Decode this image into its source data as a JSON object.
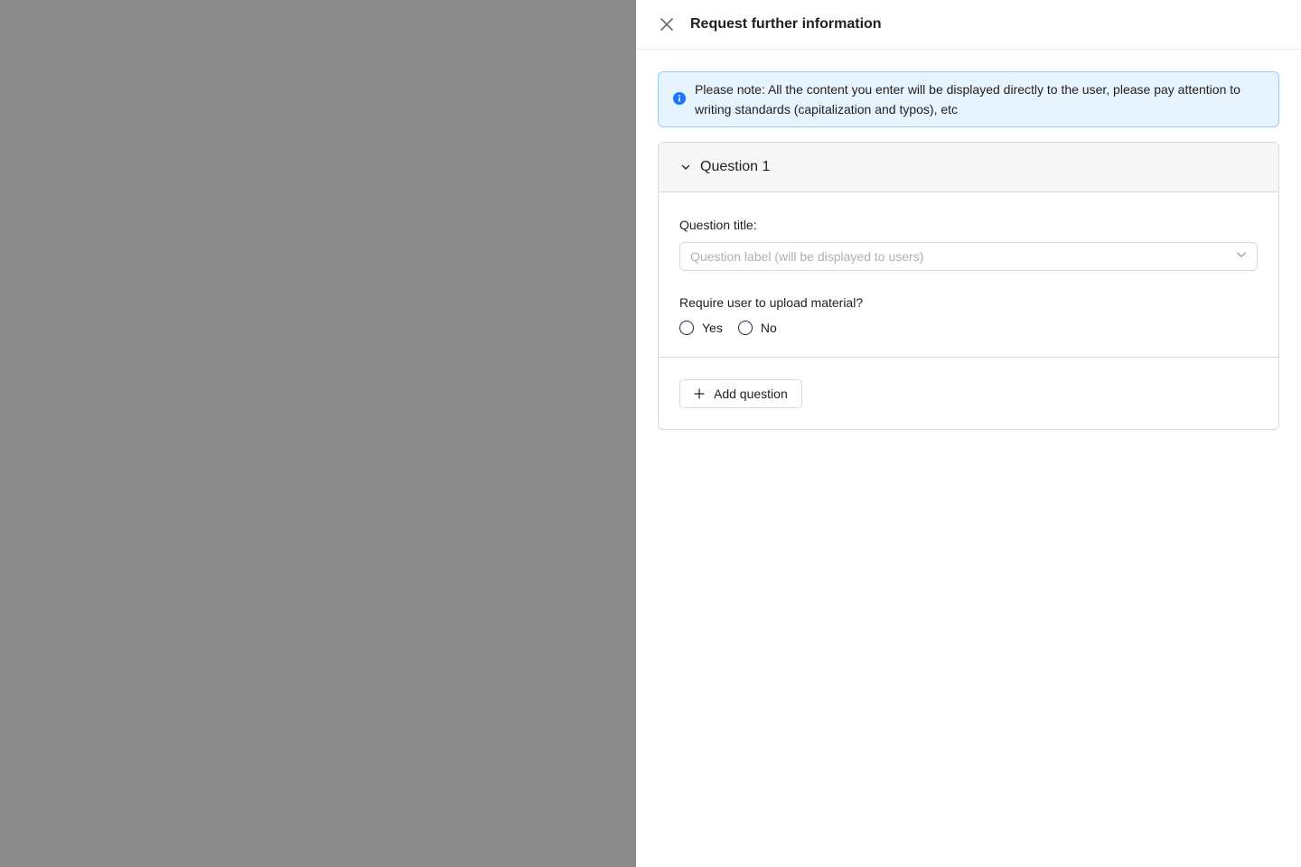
{
  "drawer": {
    "title": "Request further information",
    "close_icon": "close-icon"
  },
  "alert": {
    "icon": "info-icon",
    "color": "#1677ff",
    "text": "Please note: All the content you enter will be displayed directly to the user, please pay attention to writing standards (capitalization and typos), etc"
  },
  "questions": [
    {
      "header": "Question 1",
      "expanded": true,
      "title_label": "Question title:",
      "title_placeholder": "Question label (will be displayed to users)",
      "upload_label": "Require user to upload material?",
      "upload_options": [
        "Yes",
        "No"
      ],
      "upload_selected": null
    }
  ],
  "add_question_label": "Add question",
  "colors": {
    "overlay": "#8c8c8c",
    "alert_bg": "#e6f4ff",
    "alert_border": "#91caff",
    "accent": "#1677ff"
  }
}
